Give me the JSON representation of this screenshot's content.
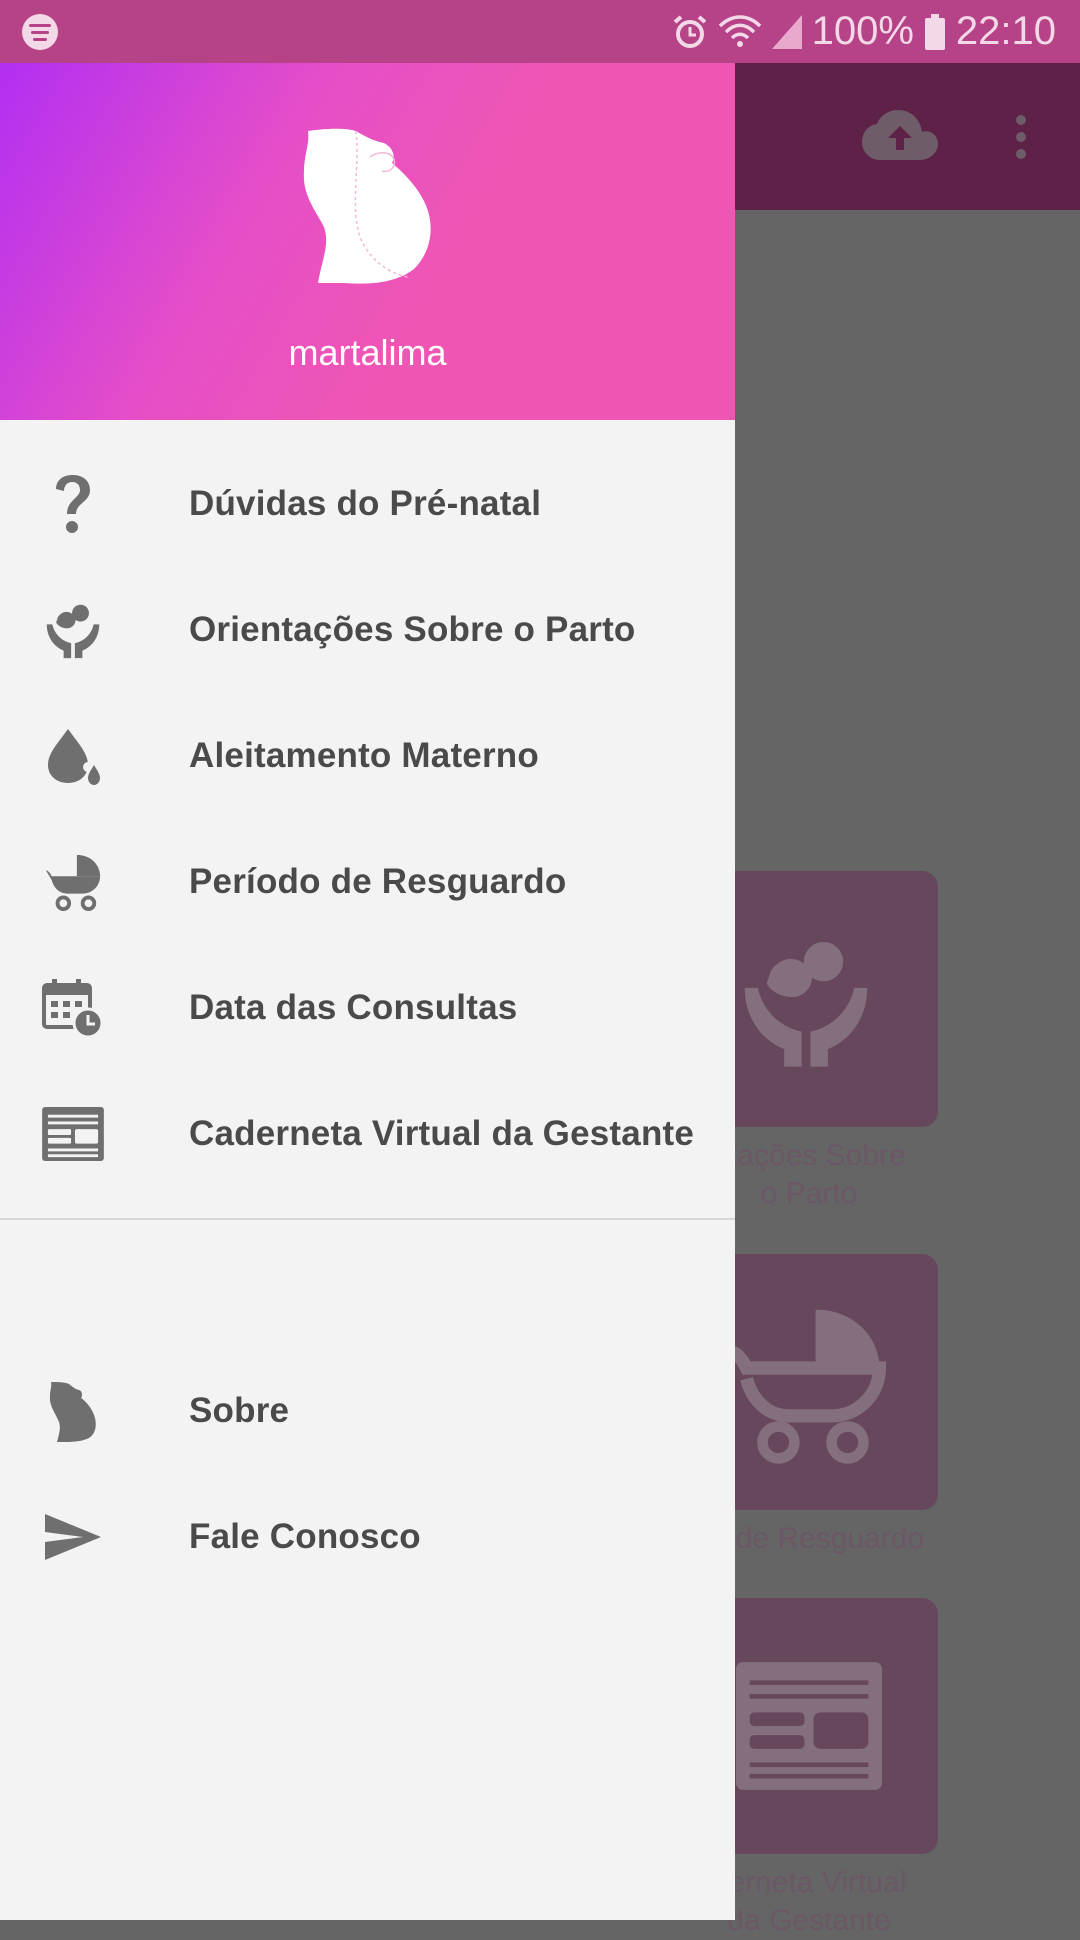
{
  "status_bar": {
    "battery": "100%",
    "time": "22:10",
    "icons": [
      "spotify-icon",
      "alarm-icon",
      "wifi-icon",
      "signal-icon",
      "battery-icon"
    ]
  },
  "app_background": {
    "toolbar_icons": [
      "cloud-upload-icon",
      "more-vert-icon"
    ],
    "tiles": [
      {
        "label_line1": "ntações Sobre",
        "label_line2": "o Parto",
        "icon": "baby-hands-icon"
      },
      {
        "label_line1": "do de Resguardo",
        "label_line2": "",
        "icon": "stroller-icon"
      },
      {
        "label_line1": "derneta Virtual",
        "label_line2": "da Gestante",
        "icon": "newspaper-icon"
      }
    ]
  },
  "drawer": {
    "header": {
      "username": "martalima",
      "avatar_icon": "pregnant-woman-icon",
      "gradient_colors": [
        "#b22ff2",
        "#ef56b4"
      ]
    },
    "menu": [
      {
        "label": "Dúvidas do Pré-natal",
        "icon": "question-mark-icon"
      },
      {
        "label": "Orientações Sobre o Parto",
        "icon": "baby-hands-icon"
      },
      {
        "label": "Aleitamento Materno",
        "icon": "milk-drop-icon"
      },
      {
        "label": "Período de Resguardo",
        "icon": "stroller-icon"
      },
      {
        "label": "Data das Consultas",
        "icon": "calendar-clock-icon"
      },
      {
        "label": "Caderneta Virtual da Gestante",
        "icon": "newspaper-icon"
      }
    ],
    "secondary_menu": [
      {
        "label": "Sobre",
        "icon": "pregnant-silhouette-icon"
      },
      {
        "label": "Fale Conosco",
        "icon": "send-icon"
      }
    ]
  },
  "colors": {
    "status_bar": "#b64387",
    "toolbar": "#5e2148",
    "icon_gray": "#6f6f6f",
    "text": "#4a4a4a"
  }
}
